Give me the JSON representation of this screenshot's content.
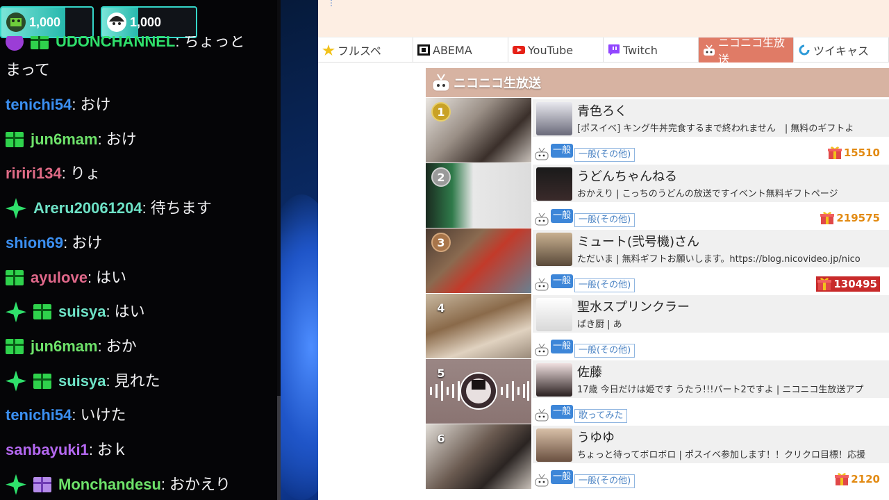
{
  "chat": {
    "points": [
      {
        "value": "1,000",
        "icon": "channel-points-icon",
        "fill": 0.7
      },
      {
        "value": "1,000",
        "icon": "user-avatar-icon",
        "fill": 0.38
      }
    ],
    "cut_message": {
      "name": "UDONCHANNEL",
      "name_color": "#2fe06b",
      "text": "ちょっと",
      "continued": "まって"
    },
    "messages": [
      {
        "name": "tenichi54",
        "color": "#3b8ff0",
        "text": "おけ",
        "badges": []
      },
      {
        "name": "jun6mam",
        "color": "#6ee26a",
        "text": "おけ",
        "badges": [
          "gift"
        ]
      },
      {
        "name": "ririri134",
        "color": "#e06b86",
        "text": "りょ",
        "badges": []
      },
      {
        "name": "Areru20061204",
        "color": "#6ee2c6",
        "text": "待ちます",
        "badges": [
          "star"
        ]
      },
      {
        "name": "shion69",
        "color": "#3b8ff0",
        "text": "おけ",
        "badges": []
      },
      {
        "name": "ayulove",
        "color": "#e0688a",
        "text": "はい",
        "badges": [
          "gift"
        ]
      },
      {
        "name": "suisya",
        "color": "#6ee2c6",
        "text": "はい",
        "badges": [
          "star",
          "gift"
        ]
      },
      {
        "name": "jun6mam",
        "color": "#6ee26a",
        "text": "おか",
        "badges": [
          "gift"
        ]
      },
      {
        "name": "suisya",
        "color": "#6ee2c6",
        "text": "見れた",
        "badges": [
          "star",
          "gift"
        ]
      },
      {
        "name": "tenichi54",
        "color": "#3b8ff0",
        "text": "いけた",
        "badges": []
      },
      {
        "name": "sanbayuki1",
        "color": "#b468f0",
        "text": "おｋ",
        "badges": []
      },
      {
        "name": "Monchandesu",
        "color": "#6ee26a",
        "text": "おかえり",
        "badges": [
          "star",
          "gift-purple"
        ]
      }
    ]
  },
  "browser": {
    "tabs": [
      {
        "label": "フルスペ",
        "icon": "star-icon",
        "active": false
      },
      {
        "label": "ABEMA",
        "icon": "abema-icon",
        "active": false
      },
      {
        "label": "YouTube",
        "icon": "youtube-icon",
        "active": false
      },
      {
        "label": "Twitch",
        "icon": "twitch-icon",
        "active": false
      },
      {
        "label": "ニコニコ生放送",
        "icon": "niconico-icon",
        "active": true
      },
      {
        "label": "ツイキャス",
        "icon": "twitcasting-icon",
        "active": false
      }
    ],
    "panel_title": "ニコニコ生放送",
    "streams": [
      {
        "rank": "1",
        "rank_style": "gold",
        "name": "青色ろく",
        "desc": "[ポスイベ] キング牛丼完食するまで終われません　| 無料のギフトよ",
        "badge": "一般",
        "category": "一般(その他)",
        "gift": "15510",
        "gift_style": "plain"
      },
      {
        "rank": "2",
        "rank_style": "silver",
        "name": "うどんちゃんねる",
        "desc": "おかえり | こっちのうどんの放送ですイベント無料ギフトページ",
        "badge": "一般",
        "category": "一般(その他)",
        "gift": "219575",
        "gift_style": "plain"
      },
      {
        "rank": "3",
        "rank_style": "bronze",
        "name": "ミュート(弐号機)さん",
        "desc": "ただいま | 無料ギフトお願いします。https://blog.nicovideo.jp/nico",
        "badge": "一般",
        "category": "一般(その他)",
        "gift": "130495",
        "gift_style": "redbox"
      },
      {
        "rank": "4",
        "rank_style": "plain",
        "name": "聖水スプリンクラー",
        "desc": "ばき厨 | あ",
        "badge": "一般",
        "category": "一般(その他)",
        "gift": "",
        "gift_style": "none"
      },
      {
        "rank": "5",
        "rank_style": "plain",
        "name": "佐藤",
        "desc": "17歳 今日だけは姫です うたう!!!パート2ですよ | ニコニコ生放送アプ",
        "badge": "一般",
        "category": "歌ってみた",
        "gift": "",
        "gift_style": "none"
      },
      {
        "rank": "6",
        "rank_style": "plain",
        "name": "うゆゆ",
        "desc": "ちょっと待ってボロボロ | ポスイベ参加します！！クリクロ目標！応援",
        "badge": "一般",
        "category": "一般(その他)",
        "gift": "2120",
        "gift_style": "plain"
      }
    ]
  }
}
